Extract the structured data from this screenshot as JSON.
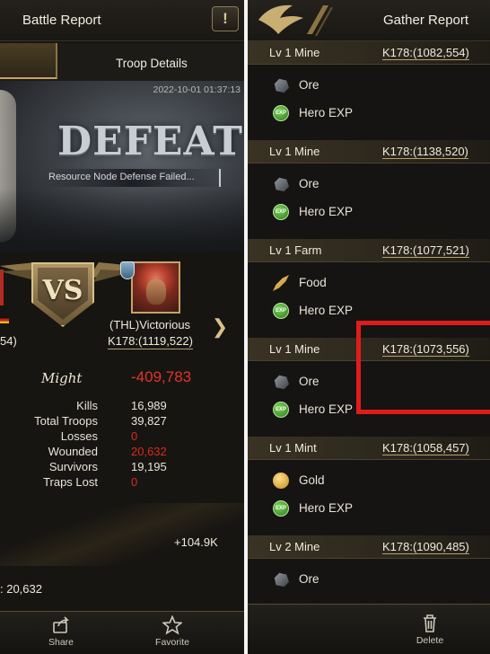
{
  "left": {
    "header_title": "Battle Report",
    "help_label": "!",
    "tab_troop_details": "Troop Details",
    "date": "2022-10-01 01:37:13",
    "result": "DEFEAT",
    "result_sub": "Resource Node Defense Failed...",
    "vs": "VS",
    "left_coords_fragment": "54)",
    "enemy_name": "(THL)Victorious",
    "enemy_coords": "K178:(1119,522)",
    "might_label": "Might",
    "might_value": "-409,783",
    "stats": [
      {
        "label": "Kills",
        "value": "16,989",
        "red": false
      },
      {
        "label": "Total Troops",
        "value": "39,827",
        "red": false
      },
      {
        "label": "Losses",
        "value": "0",
        "red": true
      },
      {
        "label": "Wounded",
        "value": "20,632",
        "red": true
      },
      {
        "label": "Survivors",
        "value": "19,195",
        "red": false
      },
      {
        "label": "Traps Lost",
        "value": "0",
        "red": true
      }
    ],
    "gain": "+104.9K",
    "bottom_fragment": ": 20,632",
    "footer": {
      "share": "Share",
      "favorite": "Favorite"
    }
  },
  "right": {
    "header_title": "Gather Report",
    "sections": [
      {
        "name": "Lv 1 Mine",
        "coords": "K178:(1082,554)",
        "items": [
          {
            "icon": "ore-icon",
            "label": "Ore"
          },
          {
            "icon": "exp-icon",
            "label": "Hero EXP"
          }
        ]
      },
      {
        "name": "Lv 1 Mine",
        "coords": "K178:(1138,520)",
        "items": [
          {
            "icon": "ore-icon",
            "label": "Ore"
          },
          {
            "icon": "exp-icon",
            "label": "Hero EXP"
          }
        ]
      },
      {
        "name": "Lv 1 Farm",
        "coords": "K178:(1077,521)",
        "items": [
          {
            "icon": "food-icon",
            "label": "Food"
          },
          {
            "icon": "exp-icon",
            "label": "Hero EXP"
          }
        ]
      },
      {
        "name": "Lv 1 Mine",
        "coords": "K178:(1073,556)",
        "items": [
          {
            "icon": "ore-icon",
            "label": "Ore"
          },
          {
            "icon": "exp-icon",
            "label": "Hero EXP"
          }
        ]
      },
      {
        "name": "Lv 1 Mint",
        "coords": "K178:(1058,457)",
        "items": [
          {
            "icon": "gold-icon",
            "label": "Gold"
          },
          {
            "icon": "exp-icon",
            "label": "Hero EXP"
          }
        ]
      },
      {
        "name": "Lv 2 Mine",
        "coords": "K178:(1090,485)",
        "items": [
          {
            "icon": "ore-icon",
            "label": "Ore"
          }
        ]
      }
    ],
    "exp_badge": "EXP",
    "footer": {
      "delete": "Delete"
    }
  },
  "colors": {
    "accent_gold": "#c3a465",
    "danger_red": "#e0352a",
    "highlight_red": "#e11b1b"
  }
}
